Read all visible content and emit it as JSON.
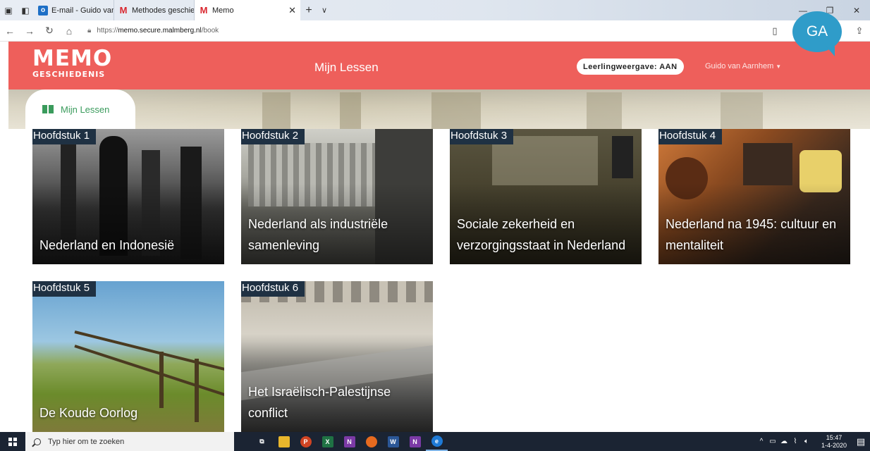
{
  "browser": {
    "tabs": [
      {
        "label": "E-mail - Guido van Aarnhen",
        "favicon": "outlook-icon"
      },
      {
        "label": "Methodes geschiedenis voc",
        "favicon": "malmberg-icon"
      },
      {
        "label": "Memo",
        "favicon": "malmberg-icon",
        "active": true
      }
    ],
    "url_prefix": "https://",
    "url_domain": "memo.secure.malmberg.nl",
    "url_path": "/book"
  },
  "header": {
    "logo_main": "MEMO",
    "logo_sub": "GESCHIEDENIS",
    "title": "Mijn Lessen",
    "student_view_toggle": "Leerlingweergave: AAN",
    "user_name": "Guido van Aarnhem",
    "avatar_initials": "GA",
    "accent_color": "#ee5f5b",
    "avatar_color": "#2f9cc9"
  },
  "banner": {
    "tab_label": "Mijn Lessen"
  },
  "chapters": [
    {
      "chip": "Hoofdstuk 1",
      "title": "Nederland en Indonesië"
    },
    {
      "chip": "Hoofdstuk 2",
      "title": "Nederland als industriële samenleving"
    },
    {
      "chip": "Hoofdstuk 3",
      "title": "Sociale zekerheid en verzorgingsstaat in Nederland"
    },
    {
      "chip": "Hoofdstuk 4",
      "title": "Nederland na 1945: cultuur en mentaliteit"
    },
    {
      "chip": "Hoofdstuk 5",
      "title": "De Koude Oorlog"
    },
    {
      "chip": "Hoofdstuk 6",
      "title": "Het Israëlisch-Palestijnse conflict"
    }
  ],
  "taskbar": {
    "search_placeholder": "Typ hier om te zoeken",
    "time": "15:47",
    "date": "1-4-2020"
  }
}
